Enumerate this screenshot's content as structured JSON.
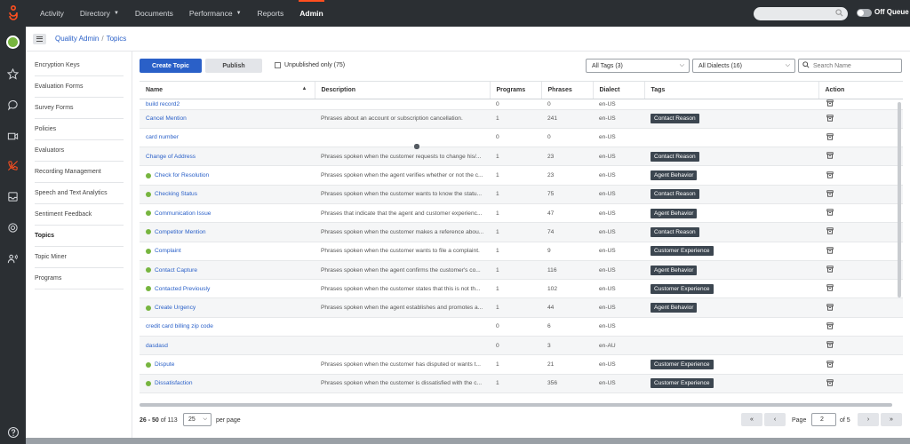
{
  "nav": {
    "items": [
      {
        "label": "Activity",
        "caret": false
      },
      {
        "label": "Directory",
        "caret": true
      },
      {
        "label": "Documents",
        "caret": false
      },
      {
        "label": "Performance",
        "caret": true
      },
      {
        "label": "Reports",
        "caret": false
      },
      {
        "label": "Admin",
        "caret": false,
        "active": true
      }
    ],
    "search_placeholder": "",
    "queue_label": "Off Queue"
  },
  "colors": {
    "accent": "#2a60c8",
    "brand": "#ff4f1f",
    "published": "#77b53f",
    "unpublished": "#555b62",
    "tag_bg": "#3c4650"
  },
  "breadcrumb": {
    "root": "Quality Admin",
    "current": "Topics"
  },
  "sidemenu": [
    {
      "label": "Encryption Keys"
    },
    {
      "label": "Evaluation Forms"
    },
    {
      "label": "Survey Forms"
    },
    {
      "label": "Policies"
    },
    {
      "label": "Evaluators"
    },
    {
      "label": "Recording Management"
    },
    {
      "label": "Speech and Text Analytics"
    },
    {
      "label": "Sentiment Feedback"
    },
    {
      "label": "Topics",
      "active": true
    },
    {
      "label": "Topic Miner"
    },
    {
      "label": "Programs"
    }
  ],
  "toolbar": {
    "create_label": "Create Topic",
    "publish_label": "Publish",
    "unpublished_label": "Unpublished only (75)",
    "tags_select": "All Tags (3)",
    "dialects_select": "All Dialects (16)",
    "search_placeholder": "Search Name"
  },
  "table": {
    "headers": {
      "name": "Name",
      "description": "Description",
      "programs": "Programs",
      "phrases": "Phrases",
      "dialect": "Dialect",
      "tags": "Tags",
      "action": "Action"
    },
    "rows": [
      {
        "name": "build record2",
        "published": false,
        "description": "",
        "programs": "0",
        "phrases": "0",
        "dialect": "en-US",
        "tag": ""
      },
      {
        "name": "Cancel Mention",
        "published": false,
        "description": "Phrases about an account or subscription cancellation.",
        "programs": "1",
        "phrases": "241",
        "dialect": "en-US",
        "tag": "Contact Reason"
      },
      {
        "name": "card number",
        "published": false,
        "description": "",
        "programs": "0",
        "phrases": "0",
        "dialect": "en-US",
        "tag": ""
      },
      {
        "name": "Change of Address",
        "published": false,
        "description": "Phrases spoken when the customer requests to change his/...",
        "programs": "1",
        "phrases": "23",
        "dialect": "en-US",
        "tag": "Contact Reason"
      },
      {
        "name": "Check for Resolution",
        "published": true,
        "description": "Phrases spoken when the agent verifies whether or not the c...",
        "programs": "1",
        "phrases": "23",
        "dialect": "en-US",
        "tag": "Agent Behavior"
      },
      {
        "name": "Checking Status",
        "published": true,
        "description": "Phrases spoken when the customer wants to know the statu...",
        "programs": "1",
        "phrases": "75",
        "dialect": "en-US",
        "tag": "Contact Reason"
      },
      {
        "name": "Communication Issue",
        "published": true,
        "description": "Phrases that indicate that the agent and customer experienc...",
        "programs": "1",
        "phrases": "47",
        "dialect": "en-US",
        "tag": "Agent Behavior"
      },
      {
        "name": "Competitor Mention",
        "published": true,
        "description": "Phrases spoken when the customer makes a reference abou...",
        "programs": "1",
        "phrases": "74",
        "dialect": "en-US",
        "tag": "Contact Reason"
      },
      {
        "name": "Complaint",
        "published": true,
        "description": "Phrases spoken when the customer wants to file a complaint.",
        "programs": "1",
        "phrases": "9",
        "dialect": "en-US",
        "tag": "Customer Experience"
      },
      {
        "name": "Contact Capture",
        "published": true,
        "description": "Phrases spoken when the agent confirms the customer's co...",
        "programs": "1",
        "phrases": "116",
        "dialect": "en-US",
        "tag": "Agent Behavior"
      },
      {
        "name": "Contacted Previously",
        "published": true,
        "description": "Phrases spoken when the customer states that this is not th...",
        "programs": "1",
        "phrases": "102",
        "dialect": "en-US",
        "tag": "Customer Experience"
      },
      {
        "name": "Create Urgency",
        "published": true,
        "description": "Phrases spoken when the agent establishes and promotes a...",
        "programs": "1",
        "phrases": "44",
        "dialect": "en-US",
        "tag": "Agent Behavior"
      },
      {
        "name": "credit card billing zip code",
        "published": false,
        "description": "",
        "programs": "0",
        "phrases": "6",
        "dialect": "en-US",
        "tag": ""
      },
      {
        "name": "dasdasd",
        "published": false,
        "description": "",
        "programs": "0",
        "phrases": "3",
        "dialect": "en-AU",
        "tag": ""
      },
      {
        "name": "Dispute",
        "published": true,
        "description": "Phrases spoken when the customer has disputed or wants t...",
        "programs": "1",
        "phrases": "21",
        "dialect": "en-US",
        "tag": "Customer Experience"
      },
      {
        "name": "Dissatisfaction",
        "published": true,
        "description": "Phrases spoken when the customer is dissatisfied with the c...",
        "programs": "1",
        "phrases": "356",
        "dialect": "en-US",
        "tag": "Customer Experience"
      }
    ]
  },
  "pagination": {
    "range": "26 - 50",
    "total": "of 113",
    "per_page_value": "25",
    "per_page_label": "per page",
    "page_label": "Page",
    "page_value": "2",
    "page_of": "of 5"
  }
}
